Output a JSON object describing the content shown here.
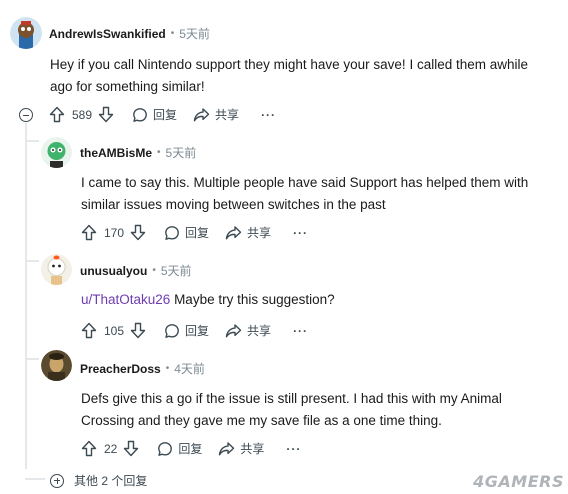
{
  "comments": [
    {
      "username": "AndrewIsSwankified",
      "separator": "•",
      "time": "5天前",
      "text_lines": [
        "Hey if you call Nintendo support they might have your save! I called them awhile",
        "ago for something similar!"
      ],
      "upvotes": "589",
      "reply_label": "回复",
      "share_label": "共享",
      "more": "···"
    },
    {
      "username": "theAMBisMe",
      "separator": "•",
      "time": "5天前",
      "text_lines": [
        "I came to say this. Multiple people have said Support has helped them with",
        "similar issues moving between switches in the past"
      ],
      "upvotes": "170",
      "reply_label": "回复",
      "share_label": "共享",
      "more": "···"
    },
    {
      "username": "unusualyou",
      "separator": "•",
      "time": "5天前",
      "mention": "u/ThatOtaku26",
      "text_rest": " Maybe try this suggestion?",
      "upvotes": "105",
      "reply_label": "回复",
      "share_label": "共享",
      "more": "···"
    },
    {
      "username": "PreacherDoss",
      "separator": "•",
      "time": "4天前",
      "text_lines": [
        "Defs give this a go if the issue is still present. I had this with my Animal",
        "Crossing and they gave me my save file as a one time thing."
      ],
      "upvotes": "22",
      "reply_label": "回复",
      "share_label": "共享",
      "more": "···"
    }
  ],
  "more_replies_label": "其他 2 个回复",
  "watermark": "4GAMERS",
  "icons": [
    "upvote-icon",
    "downvote-icon",
    "reply-icon",
    "share-icon",
    "collapse-icon",
    "expand-icon"
  ]
}
